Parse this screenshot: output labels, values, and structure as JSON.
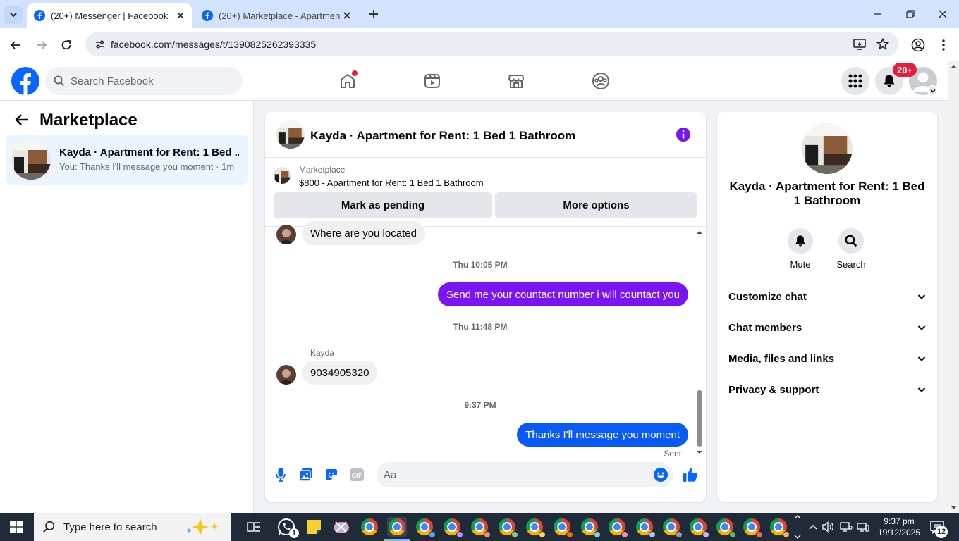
{
  "browser": {
    "tabs": [
      {
        "title": "(20+) Messenger | Facebook",
        "active": true
      },
      {
        "title": "(20+) Marketplace - Apartment",
        "active": false
      }
    ],
    "url": "facebook.com/messages/t/1390825262393335"
  },
  "header": {
    "search_placeholder": "Search Facebook",
    "notification_count": "20+"
  },
  "sidebar": {
    "title": "Marketplace",
    "conversation": {
      "name": "Kayda · Apartment for Rent: 1 Bed ...",
      "preview": "You: Thanks I'll message you moment · 1m"
    }
  },
  "chat": {
    "title": "Kayda · Apartment for Rent: 1 Bed 1 Bathroom",
    "marketplace_label": "Marketplace",
    "listing": "$800 - Apartment for Rent: 1 Bed 1 Bathroom",
    "mark_pending": "Mark as pending",
    "more_options": "More options",
    "messages": [
      {
        "text": "Where are you located"
      },
      {
        "timestamp": "Thu 10:05 PM"
      },
      {
        "text": "Send me your countact number i will countact you"
      },
      {
        "timestamp": "Thu 11:48 PM"
      },
      {
        "sender": "Kayda",
        "text": "9034905320"
      },
      {
        "timestamp": "9:37 PM"
      },
      {
        "text": "Thanks I'll message you moment",
        "status": "Sent"
      }
    ],
    "composer_placeholder": "Aa"
  },
  "right_panel": {
    "name": "Kayda · Apartment for Rent: 1 Bed 1 Bathroom",
    "mute": "Mute",
    "search": "Search",
    "sections": [
      "Customize chat",
      "Chat members",
      "Media, files and links",
      "Privacy & support"
    ]
  },
  "taskbar": {
    "search_placeholder": "Type here to search",
    "time": "9:37 pm",
    "date": "19/12/2025",
    "notification_count": "12",
    "whatsapp_badge": "1"
  },
  "colors": {
    "facebook_blue": "#0866ff",
    "messenger_purple": "#7a14f5",
    "outgoing_blue": "#0a5af5"
  }
}
